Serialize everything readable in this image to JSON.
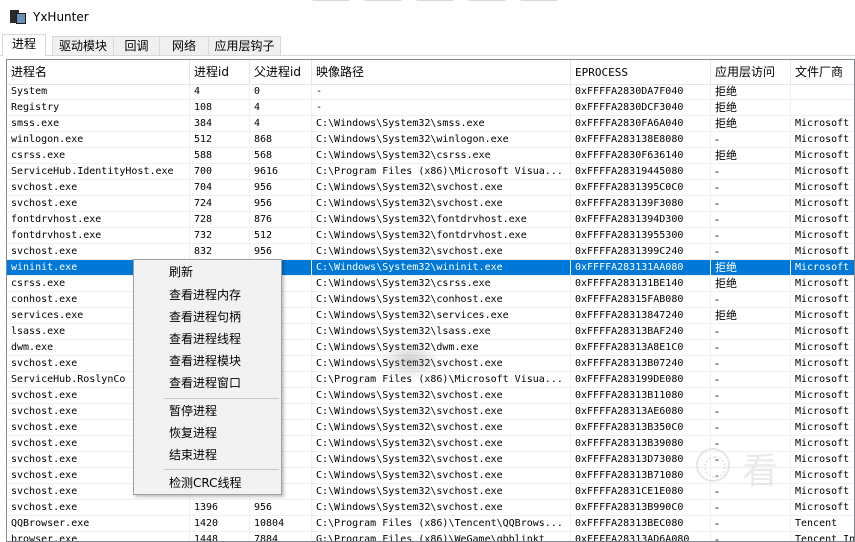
{
  "app": {
    "title": "YxHunter"
  },
  "tabs": [
    {
      "label": "进程",
      "active": true
    },
    {
      "label": "驱动模块",
      "active": false
    },
    {
      "label": "回调",
      "active": false
    },
    {
      "label": "网络",
      "active": false
    },
    {
      "label": "应用层钩子",
      "active": false
    }
  ],
  "table": {
    "columns": [
      "进程名",
      "进程id",
      "父进程id",
      "映像路径",
      "EPROCESS",
      "应用层访问",
      "文件厂商"
    ],
    "rows": [
      [
        "System",
        "4",
        "0",
        "-",
        "0xFFFFA2830DA7F040",
        "拒绝",
        ""
      ],
      [
        "Registry",
        "108",
        "4",
        "-",
        "0xFFFFA2830DCF3040",
        "拒绝",
        ""
      ],
      [
        "smss.exe",
        "384",
        "4",
        "C:\\Windows\\System32\\smss.exe",
        "0xFFFFA2830FA6A040",
        "拒绝",
        "Microsoft"
      ],
      [
        "winlogon.exe",
        "512",
        "868",
        "C:\\Windows\\System32\\winlogon.exe",
        "0xFFFFA283138E8080",
        "-",
        "Microsoft"
      ],
      [
        "csrss.exe",
        "588",
        "568",
        "C:\\Windows\\System32\\csrss.exe",
        "0xFFFFA2830F636140",
        "拒绝",
        "Microsoft"
      ],
      [
        "ServiceHub.IdentityHost.exe",
        "700",
        "9616",
        "C:\\Program Files (x86)\\Microsoft Visua...",
        "0xFFFFA28319445080",
        "-",
        "Microsoft"
      ],
      [
        "svchost.exe",
        "704",
        "956",
        "C:\\Windows\\System32\\svchost.exe",
        "0xFFFFA2831395C0C0",
        "-",
        "Microsoft"
      ],
      [
        "svchost.exe",
        "724",
        "956",
        "C:\\Windows\\System32\\svchost.exe",
        "0xFFFFA283139F3080",
        "-",
        "Microsoft"
      ],
      [
        "fontdrvhost.exe",
        "728",
        "876",
        "C:\\Windows\\System32\\fontdrvhost.exe",
        "0xFFFFA2831394D300",
        "-",
        "Microsoft"
      ],
      [
        "fontdrvhost.exe",
        "732",
        "512",
        "C:\\Windows\\System32\\fontdrvhost.exe",
        "0xFFFFA28313955300",
        "-",
        "Microsoft"
      ],
      [
        "svchost.exe",
        "832",
        "956",
        "C:\\Windows\\System32\\svchost.exe",
        "0xFFFFA2831399C240",
        "-",
        "Microsoft"
      ],
      [
        "wininit.exe",
        "",
        "",
        "C:\\Windows\\System32\\wininit.exe",
        "0xFFFFA283131AA080",
        "拒绝",
        "Microsoft"
      ],
      [
        "csrss.exe",
        "",
        "",
        "C:\\Windows\\System32\\csrss.exe",
        "0xFFFFA283131BE140",
        "拒绝",
        "Microsoft"
      ],
      [
        "conhost.exe",
        "",
        "",
        "C:\\Windows\\System32\\conhost.exe",
        "0xFFFFA28315FAB080",
        "-",
        "Microsoft"
      ],
      [
        "services.exe",
        "",
        "",
        "C:\\Windows\\System32\\services.exe",
        "0xFFFFA28313847240",
        "拒绝",
        "Microsoft"
      ],
      [
        "lsass.exe",
        "",
        "",
        "C:\\Windows\\System32\\lsass.exe",
        "0xFFFFA28313BAF240",
        "-",
        "Microsoft"
      ],
      [
        "dwm.exe",
        "",
        "",
        "C:\\Windows\\System32\\dwm.exe",
        "0xFFFFA28313A8E1C0",
        "-",
        "Microsoft"
      ],
      [
        "svchost.exe",
        "",
        "",
        "C:\\Windows\\System32\\svchost.exe",
        "0xFFFFA28313B07240",
        "-",
        "Microsoft"
      ],
      [
        "ServiceHub.RoslynCo",
        "",
        "",
        "C:\\Program Files (x86)\\Microsoft Visua...",
        "0xFFFFA283199DE080",
        "-",
        "Microsoft"
      ],
      [
        "svchost.exe",
        "",
        "",
        "C:\\Windows\\System32\\svchost.exe",
        "0xFFFFA28313B11080",
        "-",
        "Microsoft"
      ],
      [
        "svchost.exe",
        "",
        "",
        "C:\\Windows\\System32\\svchost.exe",
        "0xFFFFA28313AE6080",
        "-",
        "Microsoft"
      ],
      [
        "svchost.exe",
        "",
        "",
        "C:\\Windows\\System32\\svchost.exe",
        "0xFFFFA28313B350C0",
        "-",
        "Microsoft"
      ],
      [
        "svchost.exe",
        "",
        "",
        "C:\\Windows\\System32\\svchost.exe",
        "0xFFFFA28313B39080",
        "-",
        "Microsoft"
      ],
      [
        "svchost.exe",
        "",
        "",
        "C:\\Windows\\System32\\svchost.exe",
        "0xFFFFA28313D73080",
        "-",
        "Microsoft"
      ],
      [
        "svchost.exe",
        "",
        "",
        "C:\\Windows\\System32\\svchost.exe",
        "0xFFFFA28313B71080",
        "-",
        "Microsoft"
      ],
      [
        "svchost.exe",
        "",
        "",
        "C:\\Windows\\System32\\svchost.exe",
        "0xFFFFA2831CE1E080",
        "-",
        "Microsoft"
      ],
      [
        "svchost.exe",
        "1396",
        "956",
        "C:\\Windows\\System32\\svchost.exe",
        "0xFFFFA28313B990C0",
        "-",
        "Microsoft"
      ],
      [
        "QQBrowser.exe",
        "1420",
        "10804",
        "C:\\Program Files (x86)\\Tencent\\QQBrows...",
        "0xFFFFA28313BEC080",
        "-",
        "Tencent"
      ],
      [
        "browser.exe",
        "1448",
        "7884",
        "G:\\Program Files (x86)\\WeGame\\qbblinkt",
        "0xFFFFA28313AD6A080",
        "-",
        "Tencent In"
      ]
    ],
    "selected_row_index": 11
  },
  "context_menu": {
    "items": [
      "刷新",
      "查看进程内存",
      "查看进程句柄",
      "查看进程线程",
      "查看进程模块",
      "查看进程窗口",
      "暂停进程",
      "恢复进程",
      "结束进程",
      "检测CRC线程"
    ]
  },
  "watermark": {
    "text": "看"
  },
  "colors": {
    "selection": "#0078d7",
    "menu_bg": "#f2f2f2"
  }
}
